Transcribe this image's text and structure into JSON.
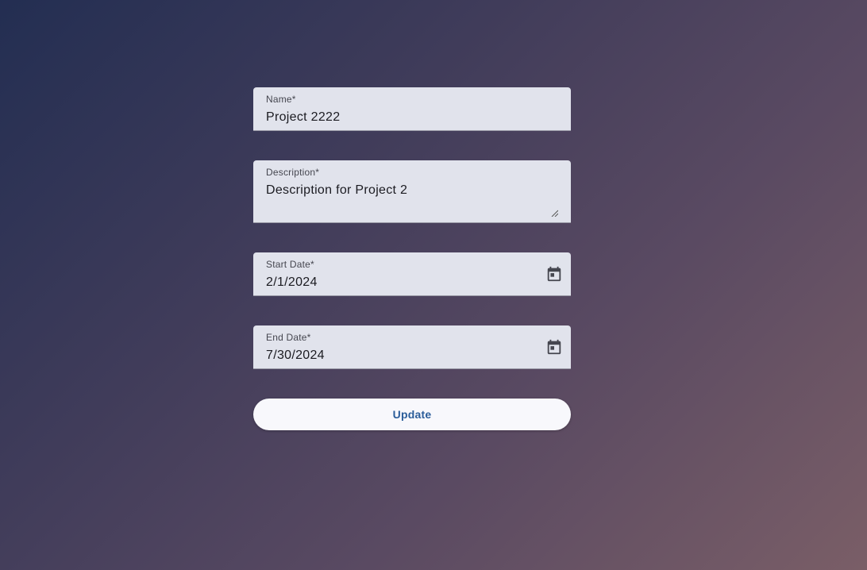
{
  "form": {
    "name": {
      "label": "Name*",
      "value": "Project 2222"
    },
    "description": {
      "label": "Description*",
      "value": "Description for Project 2"
    },
    "start_date": {
      "label": "Start Date*",
      "value": "2/1/2024",
      "icon": "calendar-icon"
    },
    "end_date": {
      "label": "End Date*",
      "value": "7/30/2024",
      "icon": "calendar-icon"
    },
    "update_label": "Update"
  },
  "colors": {
    "field_background": "#e1e3ec",
    "button_text": "#2b5d9a",
    "button_background": "#f8f8fc"
  }
}
